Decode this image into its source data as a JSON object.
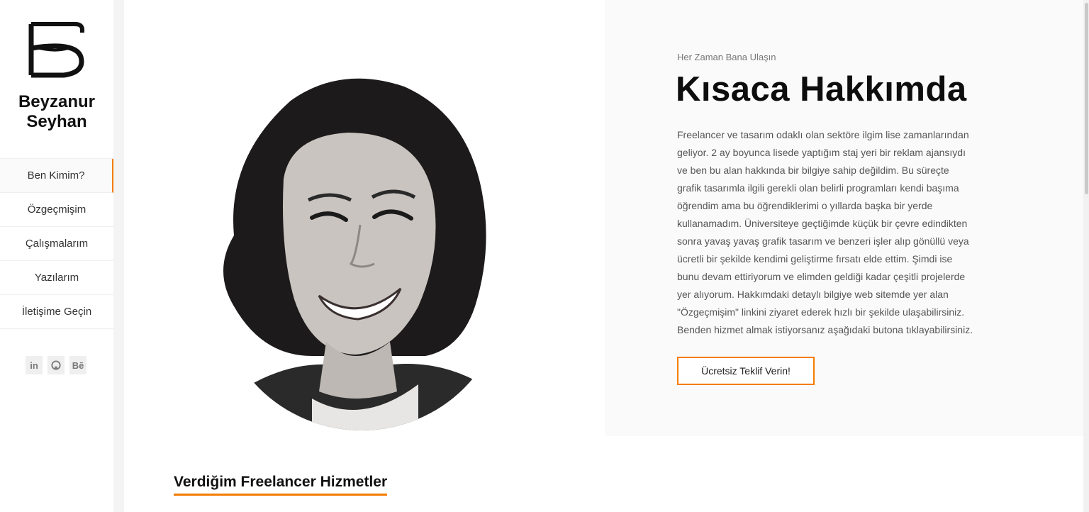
{
  "sidebar": {
    "name_line1": "Beyzanur",
    "name_line2": "Seyhan",
    "nav": [
      {
        "label": "Ben Kimim?",
        "active": true
      },
      {
        "label": "Özgeçmişim"
      },
      {
        "label": "Çalışmalarım"
      },
      {
        "label": "Yazılarım"
      },
      {
        "label": "İletişime Geçin"
      }
    ],
    "socials": [
      {
        "icon": "linkedin-icon",
        "glyph": "in"
      },
      {
        "icon": "github-icon",
        "glyph": ""
      },
      {
        "icon": "behance-icon",
        "glyph": "Bē"
      }
    ]
  },
  "about": {
    "eyebrow": "Her Zaman Bana Ulaşın",
    "title": "Kısaca Hakkımda",
    "lines": [
      "Freelancer ve tasarım odaklı olan sektöre ilgim lise zamanlarından",
      "geliyor. 2 ay boyunca lisede yaptığım staj yeri bir reklam ajansıydı",
      "ve ben bu alan hakkında bir bilgiye sahip değildim. Bu süreçte",
      "grafik tasarımla ilgili gerekli olan belirli programları kendi başıma",
      "öğrendim ama bu öğrendiklerimi o yıllarda başka bir yerde",
      "kullanamadım. Üniversiteye geçtiğimde küçük bir çevre edindikten",
      "sonra yavaş yavaş grafik tasarım ve benzeri işler alıp gönüllü veya",
      "ücretli bir şekilde kendimi geliştirme fırsatı elde ettim. Şimdi ise",
      "bunu devam ettiriyorum ve elimden geldiği kadar çeşitli projelerde",
      "yer alıyorum. Hakkımdaki detaylı bilgiye web sitemde yer alan",
      "\"Özgeçmişim\" linkini ziyaret ederek hızlı bir şekilde ulaşabilirsiniz.",
      "Benden hizmet almak istiyorsanız aşağıdaki butona tıklayabilirsiniz."
    ],
    "cta_label": "Ücretsiz Teklif Verin!"
  },
  "services": {
    "title": "Verdiğim Freelancer Hizmetler"
  },
  "colors": {
    "accent": "#f57c00",
    "panel_bg": "#fafafa"
  }
}
